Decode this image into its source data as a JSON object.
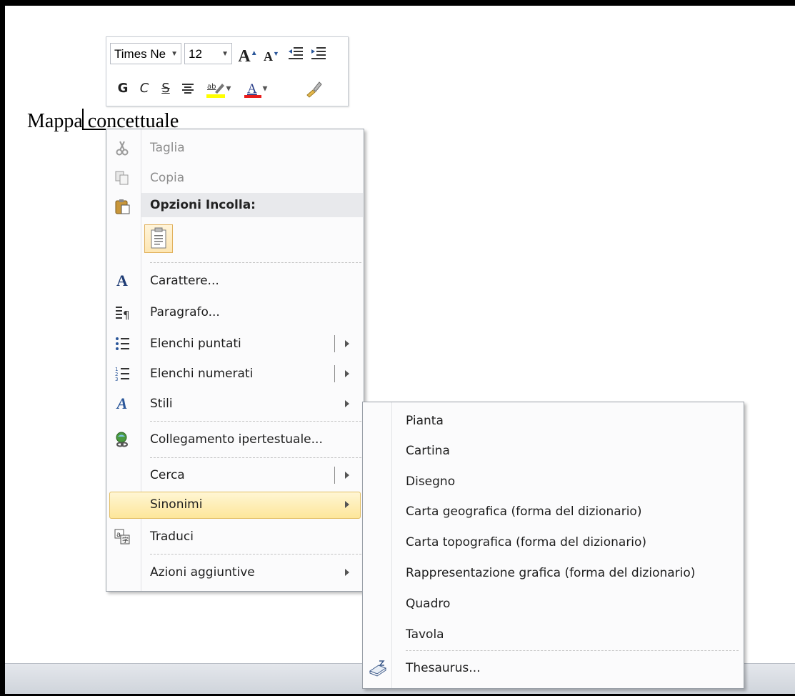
{
  "document": {
    "text_before_cursor": "Mappa",
    "text_after_cursor": " concettuale"
  },
  "mini_toolbar": {
    "font_name": "Times Ne",
    "font_size": "12",
    "bold": "G",
    "italic": "C",
    "strike": "S"
  },
  "context_menu": {
    "items": [
      {
        "label": "Taglia",
        "icon": "scissors-icon",
        "disabled": true
      },
      {
        "label": "Copia",
        "icon": "copy-icon",
        "disabled": true
      },
      {
        "label": "Opzioni Incolla:",
        "icon": "paste-icon"
      },
      {
        "label": "Carattere...",
        "icon": "font-icon"
      },
      {
        "label": "Paragrafo...",
        "icon": "paragraph-icon"
      },
      {
        "label": "Elenchi puntati",
        "icon": "bullets-icon",
        "submenu": true
      },
      {
        "label": "Elenchi numerati",
        "icon": "numbering-icon",
        "submenu": true
      },
      {
        "label": "Stili",
        "icon": "styles-icon",
        "submenu": true
      },
      {
        "label": "Collegamento ipertestuale...",
        "icon": "hyperlink-icon"
      },
      {
        "label": "Cerca",
        "submenu": true
      },
      {
        "label": "Sinonimi",
        "submenu": true,
        "highlighted": true
      },
      {
        "label": "Traduci",
        "icon": "translate-icon"
      },
      {
        "label": "Azioni aggiuntive",
        "submenu": true
      }
    ]
  },
  "synonyms_submenu": {
    "items": [
      "Pianta",
      "Cartina",
      "Disegno",
      "Carta geografica (forma del dizionario)",
      "Carta topografica (forma del dizionario)",
      "Rappresentazione grafica (forma del dizionario)",
      "Quadro",
      "Tavola"
    ],
    "thesaurus_label": "Thesaurus..."
  },
  "colors": {
    "highlight": "#fde69a",
    "highlight_border": "#e2be63",
    "font_color_bar": "#e81c1c",
    "highlight_color_bar": "#ffff00"
  }
}
